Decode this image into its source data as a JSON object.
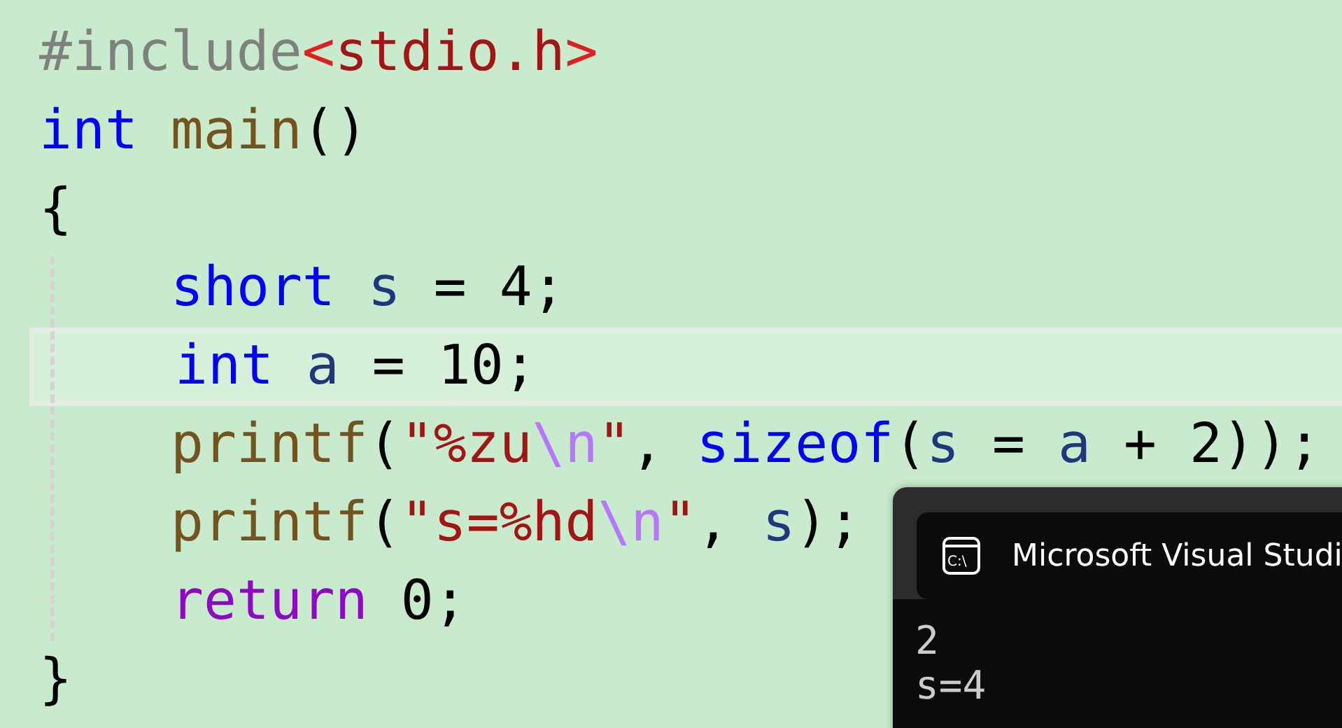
{
  "editor": {
    "lines": [
      {
        "current": false,
        "indented": false,
        "tokens": [
          {
            "text": "#include",
            "kind": "preprocessor"
          },
          {
            "text": "<",
            "kind": "bracket"
          },
          {
            "text": "stdio.h",
            "kind": "string"
          },
          {
            "text": ">",
            "kind": "bracket"
          }
        ]
      },
      {
        "current": false,
        "indented": false,
        "tokens": [
          {
            "text": "int",
            "kind": "keyword"
          },
          {
            "text": " main",
            "kind": "function"
          },
          {
            "text": "()",
            "kind": "plain"
          }
        ]
      },
      {
        "current": false,
        "indented": false,
        "tokens": [
          {
            "text": "{",
            "kind": "plain"
          }
        ]
      },
      {
        "current": false,
        "indented": true,
        "tokens": [
          {
            "text": "short",
            "kind": "keyword"
          },
          {
            "text": " s",
            "kind": "variable"
          },
          {
            "text": " = 4;",
            "kind": "plain"
          }
        ]
      },
      {
        "current": true,
        "indented": true,
        "tokens": [
          {
            "text": "int",
            "kind": "keyword"
          },
          {
            "text": " a",
            "kind": "variable"
          },
          {
            "text": " = 10;",
            "kind": "plain"
          }
        ]
      },
      {
        "current": false,
        "indented": true,
        "tokens": [
          {
            "text": "printf",
            "kind": "function"
          },
          {
            "text": "(",
            "kind": "plain"
          },
          {
            "text": "\"%zu",
            "kind": "string"
          },
          {
            "text": "\\n",
            "kind": "escape"
          },
          {
            "text": "\"",
            "kind": "string"
          },
          {
            "text": ", ",
            "kind": "plain"
          },
          {
            "text": "sizeof",
            "kind": "keyword"
          },
          {
            "text": "(",
            "kind": "plain"
          },
          {
            "text": "s",
            "kind": "variable"
          },
          {
            "text": " = ",
            "kind": "plain"
          },
          {
            "text": "a",
            "kind": "variable"
          },
          {
            "text": " + 2));",
            "kind": "plain"
          }
        ]
      },
      {
        "current": false,
        "indented": true,
        "tokens": [
          {
            "text": "printf",
            "kind": "function"
          },
          {
            "text": "(",
            "kind": "plain"
          },
          {
            "text": "\"s=%hd",
            "kind": "string"
          },
          {
            "text": "\\n",
            "kind": "escape"
          },
          {
            "text": "\"",
            "kind": "string"
          },
          {
            "text": ", ",
            "kind": "plain"
          },
          {
            "text": "s",
            "kind": "variable"
          },
          {
            "text": ");",
            "kind": "plain"
          }
        ]
      },
      {
        "current": false,
        "indented": true,
        "tokens": [
          {
            "text": "return",
            "kind": "control"
          },
          {
            "text": " 0;",
            "kind": "plain"
          }
        ]
      },
      {
        "current": false,
        "indented": false,
        "tokens": [
          {
            "text": "}",
            "kind": "plain"
          }
        ]
      }
    ]
  },
  "console": {
    "icon_label": "C:\\",
    "title": "Microsoft Visual Studi",
    "output": [
      "2",
      "s=4"
    ]
  }
}
